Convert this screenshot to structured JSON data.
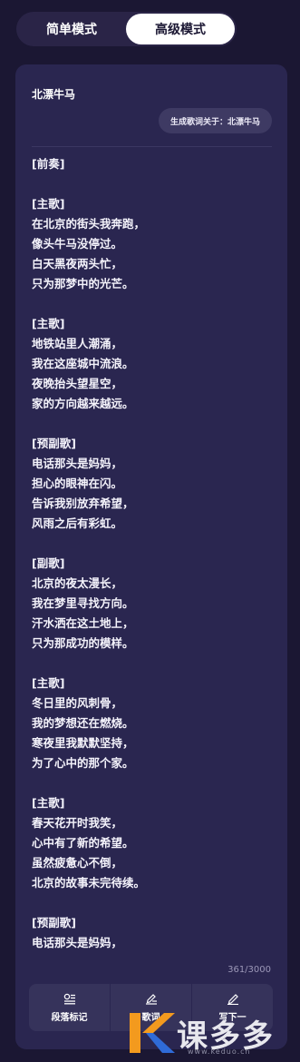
{
  "mode_tabs": {
    "simple_label": "简单模式",
    "advanced_label": "高级模式",
    "active": "advanced"
  },
  "panel": {
    "song_title": "北漂牛马",
    "generate_chip": "生成歌词关于：北漂牛马",
    "lyrics": [
      "[前奏]",
      "",
      "[主歌]",
      "在北京的街头我奔跑，",
      "像头牛马没停过。",
      "白天黑夜两头忙，",
      "只为那梦中的光芒。",
      "",
      "[主歌]",
      "地铁站里人潮涌，",
      "我在这座城中流浪。",
      "夜晚抬头望星空，",
      "家的方向越来越远。",
      "",
      "[预副歌]",
      "电话那头是妈妈，",
      "担心的眼神在闪。",
      "告诉我别放弃希望，",
      "风雨之后有彩虹。",
      "",
      "[副歌]",
      "北京的夜太漫长，",
      "我在梦里寻找方向。",
      "汗水洒在这土地上，",
      "只为那成功的模样。",
      "",
      "[主歌]",
      "冬日里的风刺骨，",
      "我的梦想还在燃烧。",
      "寒夜里我默默坚持，",
      "为了心中的那个家。",
      "",
      "[主歌]",
      "春天花开时我笑，",
      "心中有了新的希望。",
      "虽然疲惫心不倒，",
      "北京的故事未完待续。",
      "",
      "[预副歌]",
      "电话那头是妈妈，"
    ],
    "char_count": "361/3000"
  },
  "toolbar": {
    "items": [
      {
        "label": "段落标记",
        "icon": "paragraph-mark-icon"
      },
      {
        "label": "歌词",
        "icon": "edit-lyrics-icon"
      },
      {
        "label": "写下一",
        "icon": "pencil-icon"
      }
    ]
  },
  "watermark": {
    "brand": "课多多",
    "url": "www.keduo.cn",
    "colors": {
      "orange": "#f39a1e",
      "blue": "#2f6bd8"
    }
  },
  "colors": {
    "background": "#1b1733",
    "panel": "#2a2650",
    "chip": "#3e3a63",
    "toolbar": "#36335b",
    "active_tab": "#ffffff"
  }
}
